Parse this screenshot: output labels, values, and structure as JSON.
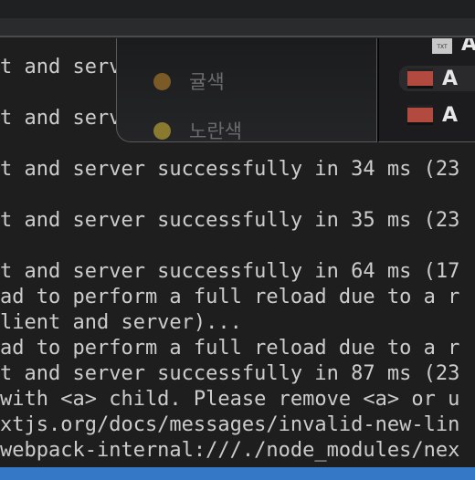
{
  "terminal": {
    "lines": [
      "t and serv",
      "",
      "t and serv",
      "",
      "t and server successfully in 34 ms (23",
      "",
      "t and server successfully in 35 ms (23",
      "",
      "t and server successfully in 64 ms (17",
      "ad to perform a full reload due to a r",
      "lient and server)...",
      "ad to perform a full reload due to a r",
      "t and server successfully in 87 ms (23",
      "with <a> child. Please remove <a> or u",
      "xtjs.org/docs/messages/invalid-new-lin",
      "webpack-internal:///./node_modules/nex"
    ]
  },
  "tags_menu": {
    "items": [
      {
        "label": "귤색",
        "color": "#7a5a26"
      },
      {
        "label": "노란색",
        "color": "#8a7a30"
      }
    ]
  },
  "file_list": {
    "items": [
      {
        "name": "A",
        "icon": "txt-file-icon",
        "icon_label": "TXT"
      },
      {
        "name": "A",
        "icon": "image-file-icon"
      },
      {
        "name": "A",
        "icon": "image-file-icon"
      }
    ]
  },
  "colors": {
    "status_bar": "#3478c6",
    "terminal_bg": "#1e1e1e"
  }
}
